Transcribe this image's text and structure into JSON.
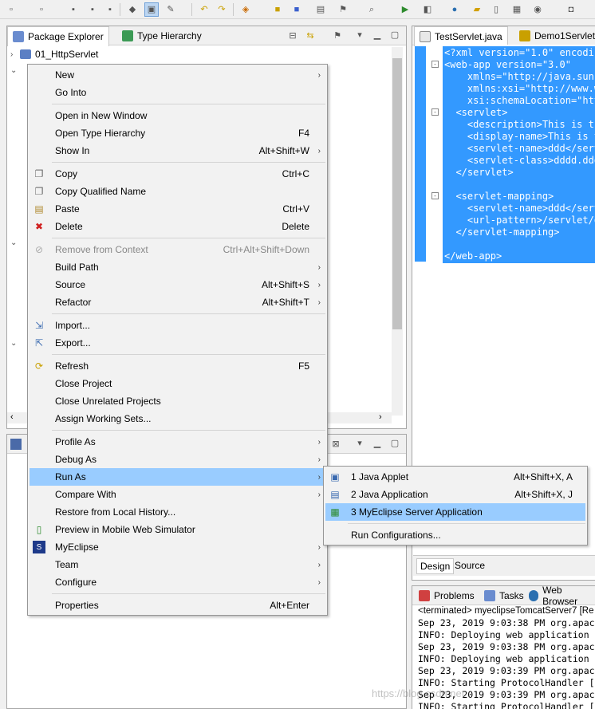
{
  "toolbar": {
    "icons": [
      "new-icon",
      "new-wizard-icon",
      "save-icon",
      "save-all-icon",
      "print-icon",
      "debug-icon",
      "deploy-icon",
      "hammer-icon",
      "back-icon",
      "forward-icon",
      "new-java-icon",
      "package-icon",
      "class-icon",
      "server-icon",
      "open-type-icon",
      "search-icon",
      "run-icon",
      "globe-icon",
      "folder-icon",
      "page-icon",
      "jsp-icon",
      "web-icon",
      "camera-icon"
    ]
  },
  "package_explorer": {
    "tabs": [
      {
        "label": "Package Explorer",
        "active": true
      },
      {
        "label": "Type Hierarchy",
        "active": false
      }
    ],
    "tree": [
      {
        "label": "01_HttpServlet",
        "expanded": false
      }
    ]
  },
  "editor": {
    "tabs": [
      {
        "label": "TestServlet.java"
      },
      {
        "label": "Demo1Servlet"
      }
    ],
    "lines": [
      "<?xml version=\"1.0\" encoding",
      "<web-app version=\"3.0\"",
      "    xmlns=\"http://java.sun.",
      "    xmlns:xsi=\"http://www.w",
      "    xsi:schemaLocation=\"http",
      "  <servlet>",
      "    <description>This is the",
      "    <display-name>This is th",
      "    <servlet-name>ddd</servl",
      "    <servlet-class>dddd.ddd",
      "  </servlet>",
      "",
      "  <servlet-mapping>",
      "    <servlet-name>ddd</servl",
      "    <url-pattern>/servlet/dd",
      "  </servlet-mapping>",
      "",
      "</web-app>"
    ],
    "bottom_tabs": [
      "Design",
      "Source"
    ]
  },
  "console": {
    "tabs": [
      "Problems",
      "Tasks",
      "Web Browser"
    ],
    "header": "<terminated> myeclipseTomcatServer7 [Re",
    "lines": [
      "Sep 23, 2019 9:03:38 PM org.apac",
      "INFO: Deploying web application",
      "Sep 23, 2019 9:03:38 PM org.apac",
      "INFO: Deploying web application",
      "Sep 23, 2019 9:03:39 PM org.apac",
      "INFO: Starting ProtocolHandler [",
      "Sep 23, 2019 9:03:39 PM org.apac",
      "INFO: Starting ProtocolHandler ["
    ]
  },
  "context_menu": {
    "items": [
      {
        "label": "New",
        "accel": "",
        "submenu": true
      },
      {
        "label": "Go Into",
        "accel": ""
      },
      {
        "label": "Open in New Window",
        "accel": ""
      },
      {
        "label": "Open Type Hierarchy",
        "accel": "F4"
      },
      {
        "label": "Show In",
        "accel": "Alt+Shift+W",
        "submenu": true
      },
      {
        "label": "Copy",
        "accel": "Ctrl+C",
        "icon": "copy-icon"
      },
      {
        "label": "Copy Qualified Name",
        "accel": "",
        "icon": "copy-qualified-icon"
      },
      {
        "label": "Paste",
        "accel": "Ctrl+V",
        "icon": "paste-icon"
      },
      {
        "label": "Delete",
        "accel": "Delete",
        "icon": "delete-icon"
      },
      {
        "label": "Remove from Context",
        "accel": "Ctrl+Alt+Shift+Down",
        "disabled": true,
        "icon": "remove-context-icon"
      },
      {
        "label": "Build Path",
        "accel": "",
        "submenu": true
      },
      {
        "label": "Source",
        "accel": "Alt+Shift+S",
        "submenu": true
      },
      {
        "label": "Refactor",
        "accel": "Alt+Shift+T",
        "submenu": true
      },
      {
        "label": "Import...",
        "accel": "",
        "icon": "import-icon"
      },
      {
        "label": "Export...",
        "accel": "",
        "icon": "export-icon"
      },
      {
        "label": "Refresh",
        "accel": "F5",
        "icon": "refresh-icon"
      },
      {
        "label": "Close Project",
        "accel": ""
      },
      {
        "label": "Close Unrelated Projects",
        "accel": ""
      },
      {
        "label": "Assign Working Sets...",
        "accel": ""
      },
      {
        "label": "Profile As",
        "accel": "",
        "submenu": true
      },
      {
        "label": "Debug As",
        "accel": "",
        "submenu": true
      },
      {
        "label": "Run As",
        "accel": "",
        "submenu": true,
        "highlight": true
      },
      {
        "label": "Compare With",
        "accel": "",
        "submenu": true
      },
      {
        "label": "Restore from Local History...",
        "accel": ""
      },
      {
        "label": "Preview in Mobile Web Simulator",
        "accel": "",
        "icon": "mobile-icon"
      },
      {
        "label": "MyEclipse",
        "accel": "",
        "submenu": true,
        "icon": "myeclipse-icon"
      },
      {
        "label": "Team",
        "accel": "",
        "submenu": true
      },
      {
        "label": "Configure",
        "accel": "",
        "submenu": true
      },
      {
        "label": "Properties",
        "accel": "Alt+Enter"
      }
    ]
  },
  "run_as_menu": {
    "items": [
      {
        "label": "1 Java Applet",
        "accel": "Alt+Shift+X, A",
        "icon": "applet-icon"
      },
      {
        "label": "2 Java Application",
        "accel": "Alt+Shift+X, J",
        "icon": "java-app-icon"
      },
      {
        "label": "3 MyEclipse Server Application",
        "accel": "",
        "icon": "server-app-icon",
        "highlight": true
      },
      {
        "label": "Run Configurations...",
        "accel": ""
      }
    ]
  },
  "watermark": "https://blog.csdn.net"
}
